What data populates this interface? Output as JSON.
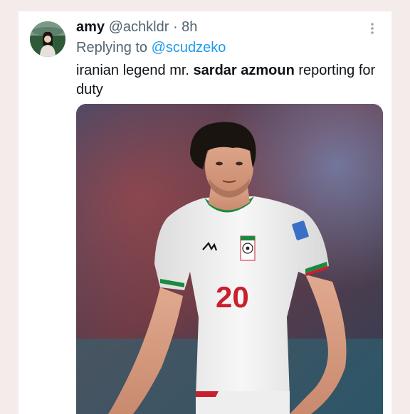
{
  "tweet": {
    "display_name": "amy",
    "handle": "@achkldr",
    "separator": "·",
    "time": "8h",
    "replying_prefix": "Replying to",
    "replying_handle": "@scudzeko",
    "text_before": "iranian legend mr. ",
    "text_bold": "sardar azmoun",
    "text_after": " reporting for duty",
    "more_icon": "vertical-ellipsis-icon"
  },
  "media": {
    "jersey_number": "20",
    "jersey_color": "#f2f2f2",
    "number_color": "#c8202f",
    "hair_color": "#1a1410"
  },
  "colors": {
    "link": "#1d9bf0",
    "secondary_text": "#536471",
    "primary_text": "#0f1419",
    "page_bg": "#f4ecea"
  }
}
